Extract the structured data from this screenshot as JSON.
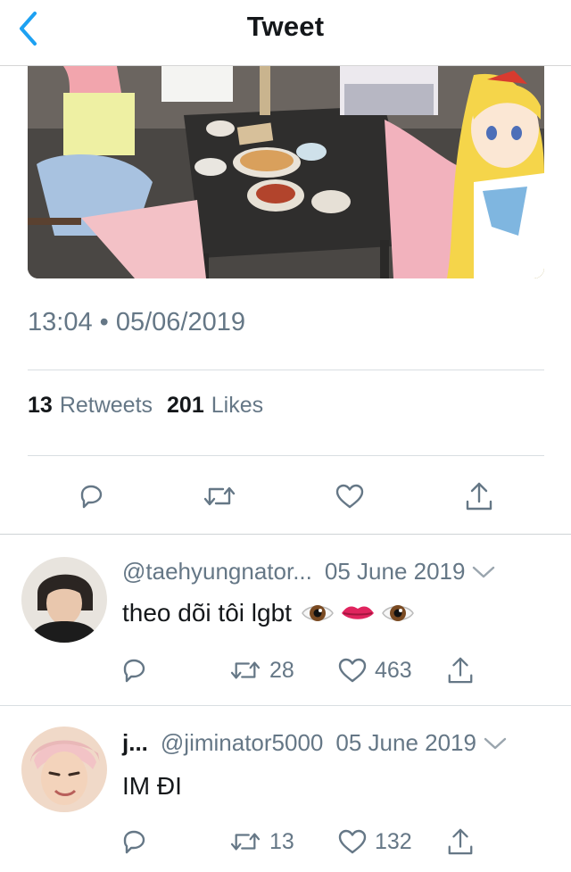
{
  "header": {
    "title": "Tweet",
    "back_icon": "chevron-left-icon"
  },
  "tweet": {
    "timestamp": "13:04 • 05/06/2019",
    "retweets_count": "13",
    "retweets_label": "Retweets",
    "likes_count": "201",
    "likes_label": "Likes",
    "actions": [
      "reply-icon",
      "retweet-icon",
      "like-icon",
      "share-icon"
    ]
  },
  "replies": [
    {
      "handle": "@taehyungnator...",
      "date": "05 June 2019",
      "text": "theo dõi tôi lgbt",
      "emojis": [
        "eye",
        "lips",
        "eye"
      ],
      "retweets": "28",
      "likes": "463"
    },
    {
      "name": "j...",
      "handle": "@jiminator5000",
      "date": "05 June 2019",
      "text": "IM ĐI",
      "retweets": "13",
      "likes": "132"
    }
  ],
  "colors": {
    "accent": "#1da1f2",
    "secondary": "#657786",
    "primary": "#14171a"
  }
}
